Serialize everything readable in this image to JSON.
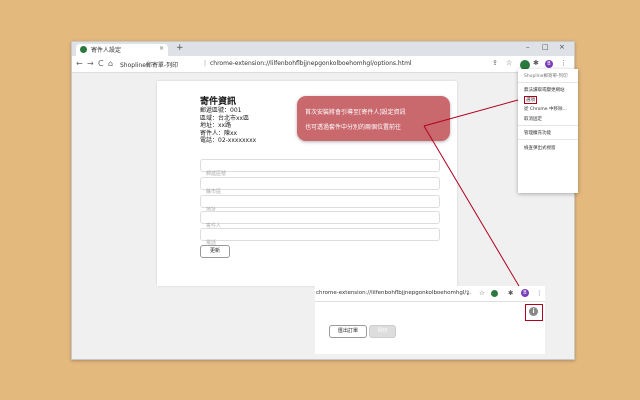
{
  "browser": {
    "tab_title": "寄件人設定",
    "tab_close": "×",
    "new_tab": "+",
    "win_min": "–",
    "win_max": "□",
    "win_close": "×",
    "url_prefix": "Shopline郵寄單-列印",
    "url_sep": "|",
    "url": "chrome-extension://lilfenbohflbjjnepgonkolboehomhgl/options.html",
    "back": "←",
    "forward": "→",
    "reload": "C",
    "home": "⌂",
    "share": "⇪",
    "star": "☆",
    "puzzle": "✱",
    "avatar": "B",
    "more": "⋮"
  },
  "sender": {
    "title": "寄件資訊",
    "lines": [
      "郵遞區號：001",
      "區域：台北市xx區",
      "地址：xx路",
      "寄件人：陳xx",
      "電話：02-xxxxxxxx"
    ]
  },
  "form": {
    "placeholders": [
      "郵遞區號",
      "縣市區",
      "地址",
      "寄件人",
      "電話"
    ],
    "submit": "更新"
  },
  "menu": {
    "items": [
      "Shopline郵寄單-列印",
      "無法讀取或變更網站",
      "選項",
      "從 Chrome 中移除...",
      "取消固定",
      "管理擴充功能",
      "檢查彈出式視窗"
    ]
  },
  "callout": {
    "line1": "首次安裝將會引導至[寄件人]設定資訊",
    "line2": "也可透過套件中分別的兩個位置前往"
  },
  "inset": {
    "url": "chrome-extension://lilfenbohflbjjnepgonkolboehomhgl/...",
    "btn_export": "匯出訂單",
    "btn_print": "列印",
    "info": "i"
  },
  "colors": {
    "background": "#e3b97e",
    "callout": "#c9696e",
    "annotation": "#b00020"
  }
}
